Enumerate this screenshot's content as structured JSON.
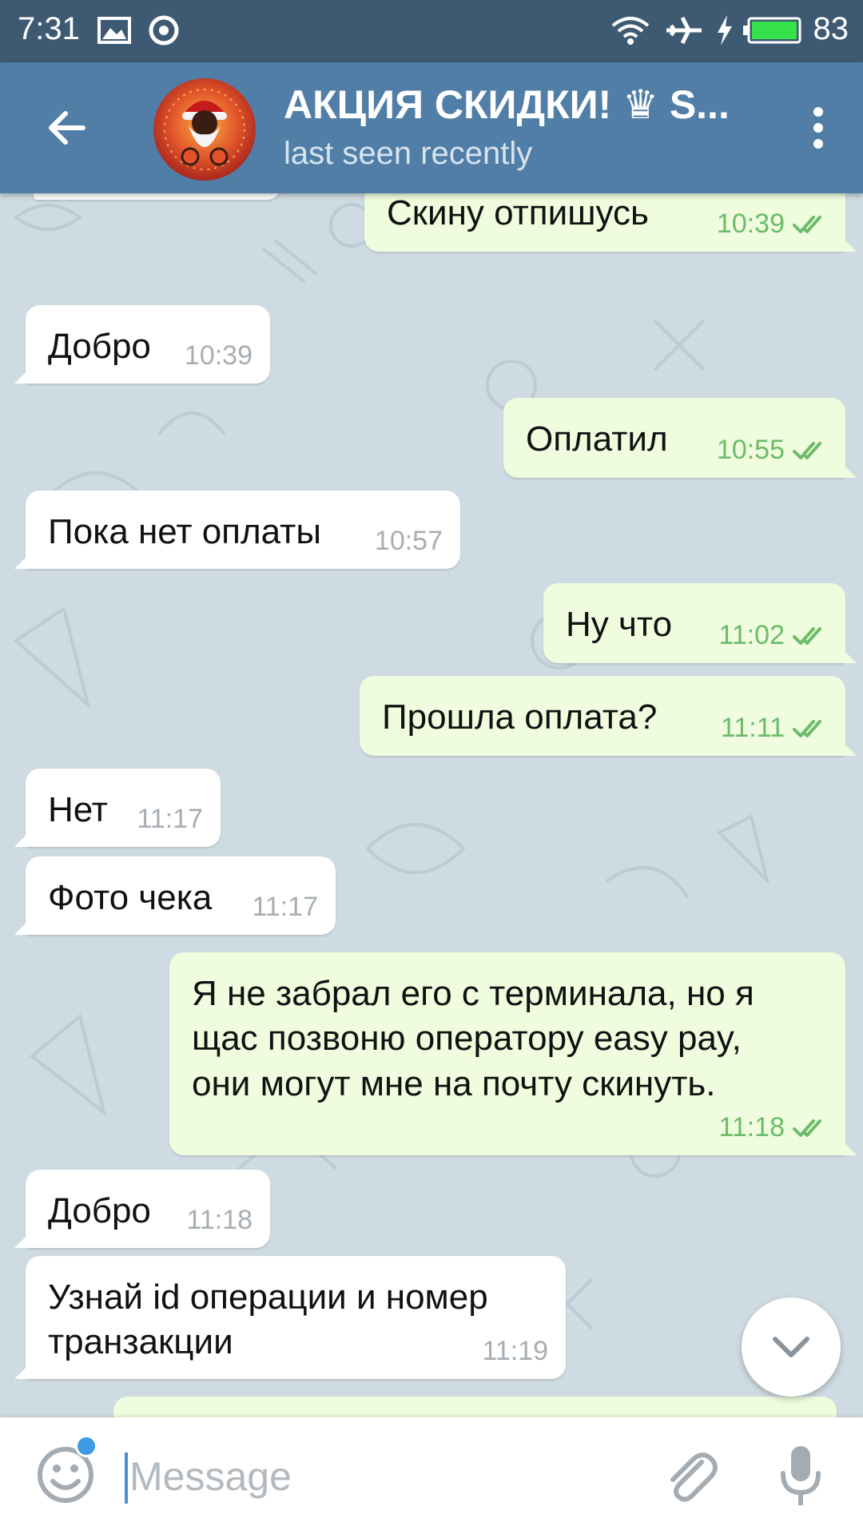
{
  "status_bar": {
    "time": "7:31",
    "battery_level": "83",
    "icons": [
      "image-icon",
      "chrome-icon",
      "wifi-icon",
      "airplane-icon",
      "charging-icon",
      "battery-icon"
    ]
  },
  "header": {
    "title": "АКЦИЯ СКИДКИ! ♛ S...",
    "subtitle": "last seen recently",
    "icons": [
      "back-arrow-icon",
      "avatar",
      "more-vert-icon"
    ]
  },
  "messages": [
    {
      "direction": "out",
      "text": "Скину отпишусь",
      "time": "10:39",
      "read": true
    },
    {
      "direction": "in",
      "text": "Добро",
      "time": "10:39"
    },
    {
      "direction": "out",
      "text": "Оплатил",
      "time": "10:55",
      "read": true
    },
    {
      "direction": "in",
      "text": "Пока нет оплаты",
      "time": "10:57"
    },
    {
      "direction": "out",
      "text": "Ну что",
      "time": "11:02",
      "read": true
    },
    {
      "direction": "out",
      "text": "Прошла оплата?",
      "time": "11:11",
      "read": true
    },
    {
      "direction": "in",
      "text": "Нет",
      "time": "11:17"
    },
    {
      "direction": "in",
      "text": "Фото чека",
      "time": "11:17"
    },
    {
      "direction": "out",
      "text": "Я не забрал его с терминала,  но я\nщас позвоню оператору easy pay,\nони могут мне на почту скинуть.",
      "time": "11:18",
      "read": true
    },
    {
      "direction": "in",
      "text": "Добро",
      "time": "11:18"
    },
    {
      "direction": "in",
      "text": "Узнай id операции и номер\nтранзакции",
      "time": "11:19"
    }
  ],
  "composer": {
    "placeholder": "Message",
    "value": "",
    "icons": [
      "emoji-icon",
      "attach-icon",
      "microphone-icon"
    ]
  },
  "colors": {
    "header": "#517ea6",
    "status_bar": "#3d5a72",
    "outgoing_bubble": "#effdde",
    "incoming_bubble": "#ffffff",
    "outgoing_time": "#6dbb6a",
    "incoming_time": "#a6aeb4"
  }
}
